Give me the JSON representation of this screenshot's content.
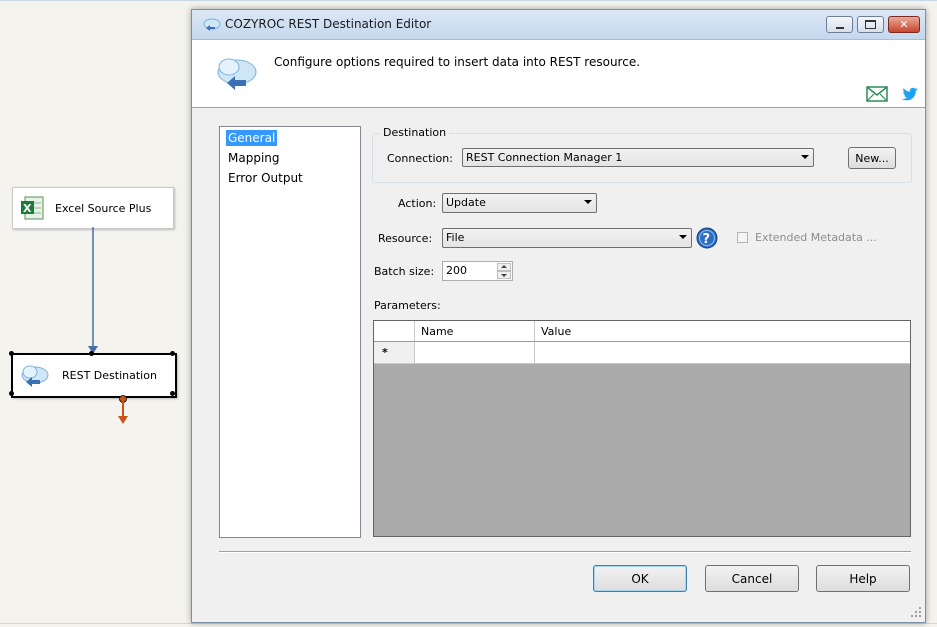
{
  "designer": {
    "tasks": [
      {
        "label": "Excel Source Plus",
        "icon": "excel-icon"
      },
      {
        "label": "REST Destination",
        "icon": "cloud-icon"
      }
    ]
  },
  "dialog": {
    "title": "COZYROC REST Destination Editor",
    "header_text": "Configure options required to insert data into REST resource.",
    "nav": [
      "General",
      "Mapping",
      "Error Output"
    ],
    "nav_selected": "General",
    "destination_group": "Destination",
    "connection_label": "Connection:",
    "connection_value": "REST Connection Manager 1",
    "new_button": "New...",
    "action_label": "Action:",
    "action_value": "Update",
    "resource_label": "Resource:",
    "resource_value": "File",
    "extended_metadata_label": "Extended Metadata ...",
    "extended_metadata_checked": false,
    "batch_size_label": "Batch size:",
    "batch_size_value": "200",
    "parameters_label": "Parameters:",
    "grid_columns": [
      "Name",
      "Value"
    ],
    "grid_new_row_marker": "*",
    "ok_button": "OK",
    "cancel_button": "Cancel",
    "help_button": "Help"
  },
  "colors": {
    "selection": "#3399ff",
    "twitter": "#1da1f2",
    "email": "#2e8b57",
    "path_arrow": "#4a6fa5",
    "error_arrow": "#c8541a"
  }
}
